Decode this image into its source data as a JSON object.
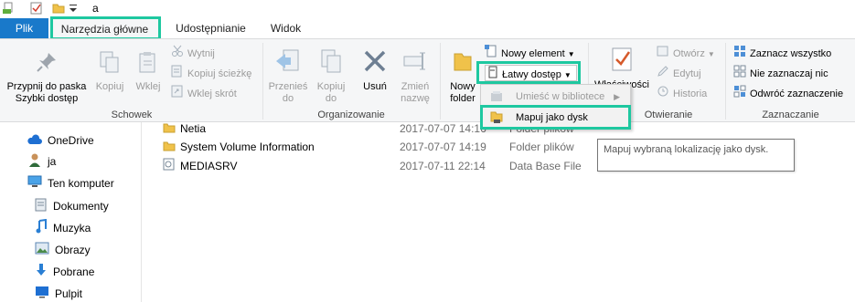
{
  "titlebar": {
    "title": "a"
  },
  "tabs": {
    "file": "Plik",
    "drive_tools": "Narzędzia główne",
    "share": "Udostępnianie",
    "view": "Widok"
  },
  "ribbon": {
    "clipboard": {
      "pin_line1": "Przypnij do paska",
      "pin_line2": "Szybki dostęp",
      "copy": "Kopiuj",
      "paste": "Wklej",
      "cut": "Wytnij",
      "copy_path": "Kopiuj ścieżkę",
      "paste_shortcut": "Wklej skrót",
      "group_label": "Schowek"
    },
    "organize": {
      "move_line1": "Przenieś",
      "move_line2": "do",
      "copyto_line1": "Kopiuj",
      "copyto_line2": "do",
      "delete": "Usuń",
      "rename_line1": "Zmień",
      "rename_line2": "nazwę",
      "group_label": "Organizowanie"
    },
    "new": {
      "new_folder_line1": "Nowy",
      "new_folder_line2": "folder",
      "new_item": "Nowy element",
      "easy_access": "Łatwy dostęp"
    },
    "open": {
      "properties": "Właściwości",
      "open": "Otwórz",
      "edit": "Edytuj",
      "history": "Historia",
      "group_label": "Otwieranie"
    },
    "select": {
      "select_all": "Zaznacz wszystko",
      "select_none": "Nie zaznaczaj nic",
      "invert": "Odwróć zaznaczenie",
      "group_label": "Zaznaczanie"
    }
  },
  "dropdown": {
    "include_library": "Umieść w bibliotece",
    "map_drive": "Mapuj jako dysk"
  },
  "tooltip": {
    "text": "Mapuj wybraną lokalizację jako dysk."
  },
  "nav": {
    "items": [
      {
        "label": "OneDrive"
      },
      {
        "label": "ja"
      },
      {
        "label": "Ten komputer"
      },
      {
        "label": "Dokumenty"
      },
      {
        "label": "Muzyka"
      },
      {
        "label": "Obrazy"
      },
      {
        "label": "Pobrane"
      },
      {
        "label": "Pulpit"
      }
    ]
  },
  "files": [
    {
      "name": "Netia",
      "date": "2017-07-07 14:16",
      "type": "Folder plików"
    },
    {
      "name": "System Volume Information",
      "date": "2017-07-07 14:19",
      "type": "Folder plików"
    },
    {
      "name": "MEDIASRV",
      "date": "2017-07-11 22:14",
      "type": "Data Base File"
    }
  ],
  "colors": {
    "accent": "#1979ca",
    "highlight": "#1ec8a0",
    "ribbon_bg": "#f5f6f7",
    "folder": "#f0c24a"
  }
}
